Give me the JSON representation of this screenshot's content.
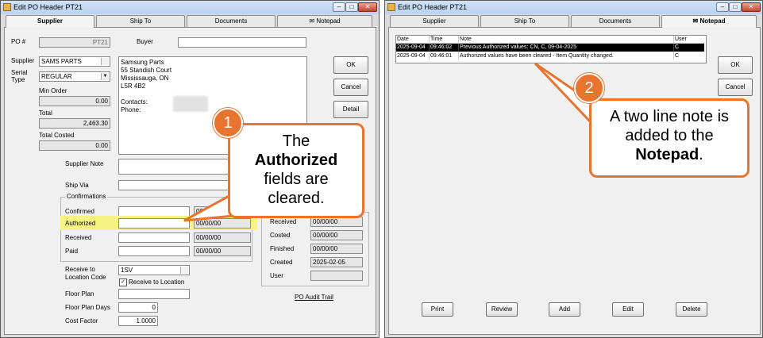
{
  "left_window": {
    "title": "Edit PO Header PT21",
    "tabs": [
      "Supplier",
      "Ship To",
      "Documents",
      "Notepad"
    ],
    "po_label": "PO #",
    "po_value": "PT21",
    "buyer_label": "Buyer",
    "buyer_value": "",
    "supplier_label": "Supplier",
    "supplier_value": "SAMS PARTS",
    "serial_type_label": "Serial Type",
    "serial_type_value": "REGULAR",
    "min_order_label": "Min Order",
    "min_order_value": "0.00",
    "total_label": "Total",
    "total_value": "2,463.30",
    "total_costed_label": "Total Costed",
    "total_costed_value": "0.00",
    "address_lines": [
      "Samsung Parts",
      "55 Standish Court",
      "Mississauga, ON",
      "L5R 4B2"
    ],
    "contacts_label": "Contacts:",
    "phone_label": "Phone:",
    "ok_button": "OK",
    "cancel_button": "Cancel",
    "detail_button": "Detail",
    "supplier_note_label": "Supplier Note",
    "ship_via_label": "Ship Via",
    "confirmations_label": "Confirmations",
    "confirmed_label": "Confirmed",
    "authorized_label": "Authorized",
    "received_label": "Received",
    "paid_label": "Paid",
    "confirmed_date": "00/",
    "authorized_date": "00/00/00",
    "received_date": "00/00/00",
    "paid_date": "00/00/00",
    "right_received_label": "Received",
    "right_received_date": "00/00/00",
    "costed_label": "Costed",
    "costed_date": "00/00/00",
    "finished_label": "Finished",
    "finished_date": "00/00/00",
    "created_label": "Created",
    "created_date": "2025-02-05",
    "user_label": "User",
    "receive_to_label": "Receive to Location Code",
    "receive_to_value": "1SV",
    "receive_to_location_checkbox": "Receive to Location",
    "floor_plan_label": "Floor Plan",
    "floor_plan_value": "",
    "floor_plan_days_label": "Floor Plan Days",
    "floor_plan_days_value": "0",
    "cost_factor_label": "Cost Factor",
    "cost_factor_value": "1.0000",
    "audit_trail_link": "PO Audit Trail"
  },
  "right_window": {
    "title": "Edit PO Header PT21",
    "tabs": [
      "Supplier",
      "Ship To",
      "Documents",
      "Notepad"
    ],
    "grid_headers": [
      "Date",
      "Time",
      "Note",
      "User"
    ],
    "grid_rows": [
      {
        "date": "2025-09-04",
        "time": "09:46:02",
        "note": "Previous Authorized values: CN, C, 09-04-2025",
        "user": "C"
      },
      {
        "date": "2025-09-04",
        "time": "09:46:01",
        "note": "Authorized values have been cleared - Item Quantity changed.",
        "user": "C"
      }
    ],
    "ok_button": "OK",
    "cancel_button": "Cancel",
    "bottom_buttons": [
      "Print",
      "Review",
      "Add",
      "Edit",
      "Delete"
    ]
  },
  "callouts": {
    "one": {
      "number": "1",
      "pre": "The",
      "bold": "Authorized",
      "post1": "fields are",
      "post2": "cleared."
    },
    "two": {
      "number": "2",
      "line1": "A two line note is",
      "line2": "added to the",
      "bold": "Notepad",
      "tail": "."
    }
  },
  "colors": {
    "accent": "#e8742f",
    "highlight": "#f7f383",
    "selected_row": "#000000"
  }
}
